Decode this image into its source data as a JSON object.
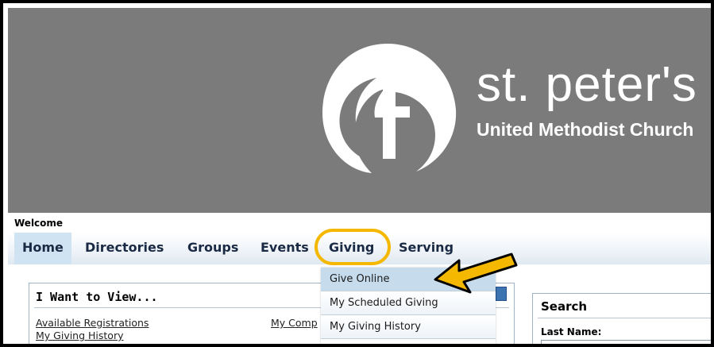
{
  "brand": {
    "name": "st. peter's",
    "subtitle": "United Methodist Church"
  },
  "welcome": "Welcome",
  "nav": {
    "items": [
      {
        "label": "Home",
        "active": true
      },
      {
        "label": "Directories"
      },
      {
        "label": "Groups"
      },
      {
        "label": "Events"
      },
      {
        "label": "Giving",
        "highlighted": true
      },
      {
        "label": "Serving"
      }
    ]
  },
  "giving_menu": {
    "items": [
      {
        "label": "Give Online",
        "hovered": true
      },
      {
        "label": "My Scheduled Giving"
      },
      {
        "label": "My Giving History"
      }
    ]
  },
  "i_want_to_view": {
    "title": "I Want to View...",
    "links": [
      "Available Registrations",
      "My Giving History",
      "My Comp"
    ]
  },
  "search": {
    "title": "Search",
    "last_name_label": "Last Name:"
  },
  "colors": {
    "header_bg": "#7b7b7b",
    "annotation": "#f5b800",
    "menu_hover": "#c6dced"
  }
}
